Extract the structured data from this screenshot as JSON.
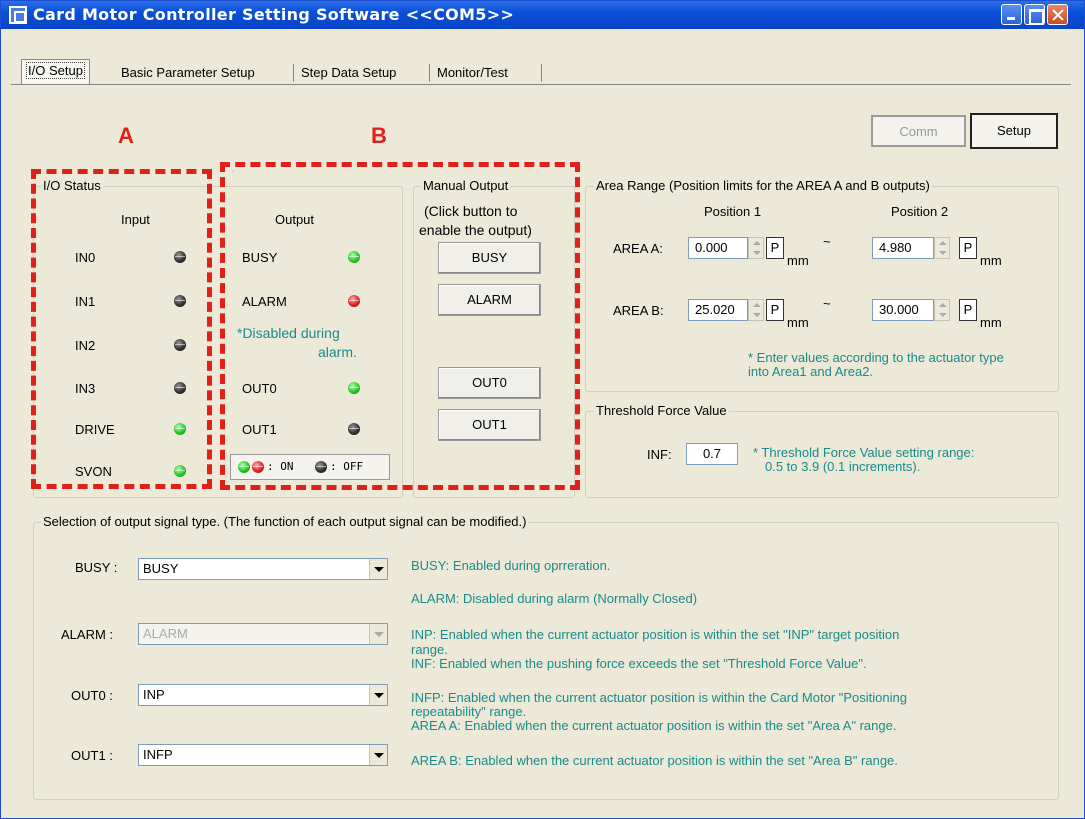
{
  "window": {
    "title": "Card Motor Controller Setting Software <<COM5>>"
  },
  "tabs": [
    "I/O Setup",
    "Basic Parameter Setup",
    "Step Data Setup",
    "Monitor/Test"
  ],
  "toolbar": {
    "comm_label": "Comm",
    "setup_label": "Setup"
  },
  "annotations": {
    "a": "A",
    "b": "B"
  },
  "io_status": {
    "legend": "I/O Status",
    "input_header": "Input",
    "output_header": "Output",
    "inputs": [
      {
        "label": "IN0",
        "state": "off"
      },
      {
        "label": "IN1",
        "state": "off"
      },
      {
        "label": "IN2",
        "state": "off"
      },
      {
        "label": "IN3",
        "state": "off"
      },
      {
        "label": "DRIVE",
        "state": "on"
      },
      {
        "label": "SVON",
        "state": "on"
      }
    ],
    "outputs": [
      {
        "label": "BUSY",
        "state": "on"
      },
      {
        "label": "ALARM",
        "state": "alarm"
      },
      {
        "label": "OUT0",
        "state": "on"
      },
      {
        "label": "OUT1",
        "state": "off"
      }
    ],
    "alarm_note_1": "*Disabled during",
    "alarm_note_2": "alarm.",
    "legend_on": ": ON",
    "legend_off": ": OFF"
  },
  "manual_output": {
    "legend": "Manual Output",
    "hint_1": "(Click button to",
    "hint_2": "enable the output)",
    "buttons": [
      "BUSY",
      "ALARM",
      "OUT0",
      "OUT1"
    ]
  },
  "area_range": {
    "legend": "Area Range (Position limits for the AREA A and B outputs)",
    "pos1_header": "Position 1",
    "pos2_header": "Position 2",
    "area_a_label": "AREA A:",
    "area_b_label": "AREA B:",
    "area_a_pos1": "0.000",
    "area_a_pos2": "4.980",
    "area_b_pos1": "25.020",
    "area_b_pos2": "30.000",
    "p_label": "P",
    "unit": "mm",
    "tilde": "~",
    "note_1": "* Enter values according to the actuator type",
    "note_2": "into Area1 and Area2."
  },
  "threshold": {
    "legend": "Threshold Force Value",
    "inf_label": "INF:",
    "inf_value": "0.7",
    "note_1": "* Threshold Force Value setting range:",
    "note_2": "0.5 to 3.9 (0.1 increments)."
  },
  "signal_selection": {
    "legend": "Selection of output signal type. (The function of each output signal can be modified.)",
    "rows": [
      {
        "label": "BUSY :",
        "value": "BUSY"
      },
      {
        "label": "ALARM :",
        "value": "ALARM"
      },
      {
        "label": "OUT0 :",
        "value": "INP"
      },
      {
        "label": "OUT1 :",
        "value": "INFP"
      }
    ],
    "desc_busy": "BUSY: Enabled during oprreration.",
    "desc_alarm": "ALARM: Disabled during alarm (Normally Closed)",
    "desc_inp_1": "INP: Enabled when the current actuator position is within the set \"INP\" target position",
    "desc_inp_2": "range.",
    "desc_inf": "INF: Enabled when the pushing force exceeds the set \"Threshold Force Value\".",
    "desc_infp_1": "INFP: Enabled when the current actuator position is within the Card Motor \"Positioning",
    "desc_infp_2": "repeatability\" range.",
    "desc_area_a": "AREA A: Enabled when the current actuator position is within the set \"Area A\" range.",
    "desc_area_b": "AREA B: Enabled when the current actuator position is within the set \"Area B\" range."
  },
  "colors": {
    "annotation_red": "#e0201a",
    "teal_text": "#1a8a8a",
    "led_on": "#22c822",
    "led_alarm": "#e02020",
    "led_off": "#333333"
  }
}
